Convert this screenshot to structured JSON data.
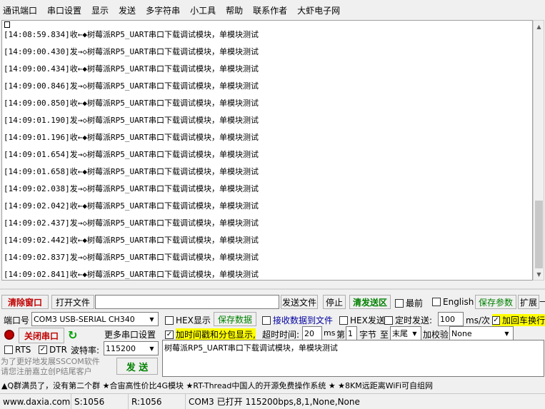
{
  "menu": [
    "通讯端口",
    "串口设置",
    "显示",
    "发送",
    "多字符串",
    "小工具",
    "帮助",
    "联系作者",
    "大虾电子网"
  ],
  "log": {
    "rows": [
      "[14:08:59.834]收←◆树莓派RP5_UART串口下载调试模块，单模块测试",
      "[14:09:00.430]发→◇树莓派RP5_UART串口下载调试模块，单模块测试",
      "[14:09:00.434]收←◆树莓派RP5_UART串口下载调试模块，单模块测试",
      "[14:09:00.846]发→◇树莓派RP5_UART串口下载调试模块，单模块测试",
      "[14:09:00.850]收←◆树莓派RP5_UART串口下载调试模块，单模块测试",
      "[14:09:01.190]发→◇树莓派RP5_UART串口下载调试模块，单模块测试",
      "[14:09:01.196]收←◆树莓派RP5_UART串口下载调试模块，单模块测试",
      "[14:09:01.654]发→◇树莓派RP5_UART串口下载调试模块，单模块测试",
      "[14:09:01.658]收←◆树莓派RP5_UART串口下载调试模块，单模块测试",
      "[14:09:02.038]发→◇树莓派RP5_UART串口下载调试模块，单模块测试",
      "[14:09:02.042]收←◆树莓派RP5_UART串口下载调试模块，单模块测试",
      "[14:09:02.437]发→◇树莓派RP5_UART串口下载调试模块，单模块测试",
      "[14:09:02.442]收←◆树莓派RP5_UART串口下载调试模块，单模块测试",
      "[14:09:02.837]发→◇树莓派RP5_UART串口下载调试模块，单模块测试",
      "[14:09:02.841]收←◆树莓派RP5_UART串口下载调试模块，单模块测试"
    ]
  },
  "toolbar": {
    "clear_window": "清除窗口",
    "open_file": "打开文件",
    "file_path": "",
    "send_file": "发送文件",
    "stop": "停止",
    "clear_send": "清发送区",
    "always_on_top": "最前",
    "english": "English",
    "save_params": "保存参数",
    "expand": "扩展",
    "expand_arrow": "—"
  },
  "port": {
    "label": "端口号",
    "value": "COM3 USB-SERIAL CH340",
    "close_port": "关闭串口",
    "more_settings": "更多串口设置",
    "rts": "RTS",
    "dtr": "DTR",
    "baud_label": "波特率:",
    "baud_value": "115200"
  },
  "options": {
    "hex_display": "HEX显示",
    "save_data": "保存数据",
    "recv_to_file": "接收数据到文件",
    "hex_send": "HEX发送",
    "timed_send": "定时发送:",
    "interval": "100",
    "interval_unit": "ms/次",
    "append_newline": "加回车换行",
    "add_timestamp": "加时间戳和分包显示,",
    "timeout_label": "超时时间:",
    "timeout_value": "20",
    "timeout_unit": "ms",
    "byte_label_pre": "第",
    "byte_index": "1",
    "byte_label_post": "字节",
    "to_label": "至",
    "to_value": "末尾",
    "checksum_label": "加校验",
    "checksum_value": "None"
  },
  "send_text": "树莓派RP5_UART串口下载调试模块，单模块测试",
  "send_button": "发 送",
  "promo": [
    "为了更好地发展SSCOM软件",
    "请您注册嘉立创P结尾客户"
  ],
  "ticker": "▲Q群满员了，没有第二个群  ★合宙高性价比4G模块  ★RT-Thread中国人的开源免费操作系统  ★  ★8KM远距离WiFi可自组网",
  "status": {
    "website": "www.daxia.com",
    "sent": "S:1056",
    "received": "R:1056",
    "port_status": "COM3 已打开  115200bps,8,1,None,None"
  }
}
